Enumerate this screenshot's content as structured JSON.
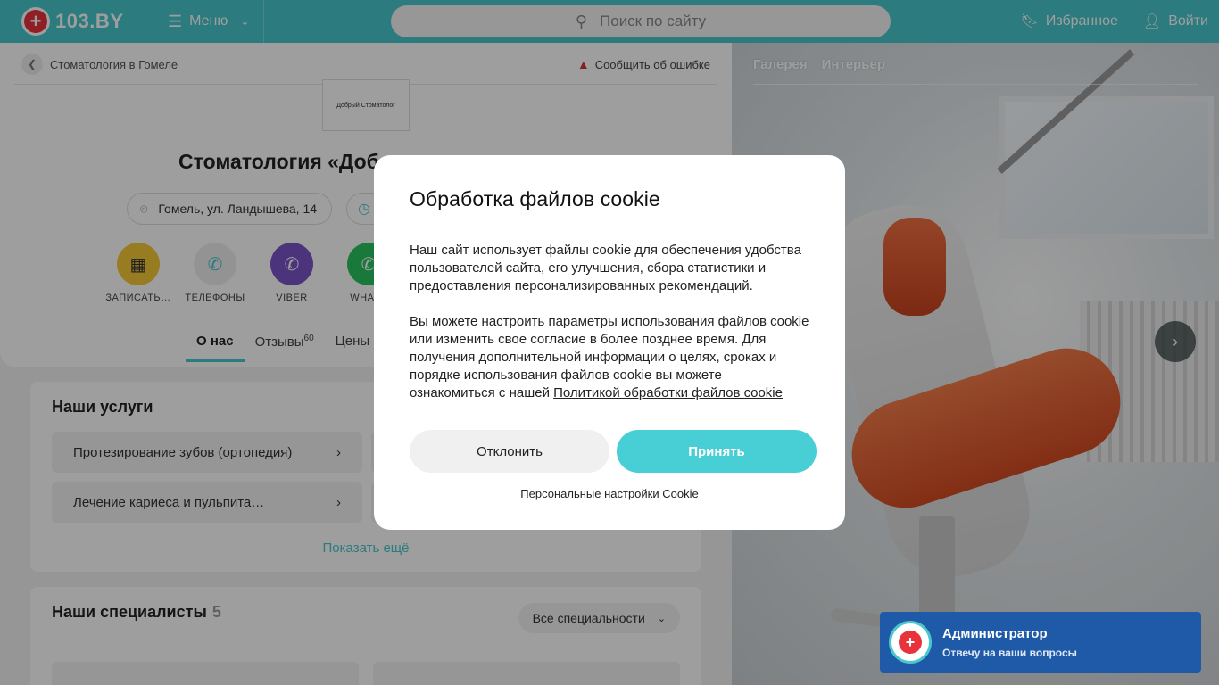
{
  "header": {
    "logo_text": "103.BY",
    "menu_label": "Меню",
    "search_placeholder": "Поиск по сайту",
    "favorites_label": "Избранное",
    "login_label": "Войти"
  },
  "breadcrumb": {
    "label": "Стоматология в Гомеле"
  },
  "report_label": "Сообщить об ошибке",
  "clinic": {
    "logo_text": "Добрый Стоматолог",
    "title": "Стоматология «Доб",
    "address": "Гомель, ул. Ландышева, 14"
  },
  "actions": [
    {
      "label": "ЗАПИСАТЬ…",
      "color": "#f6c836"
    },
    {
      "label": "ТЕЛЕФОНЫ",
      "color": "#eeeeee"
    },
    {
      "label": "VIBER",
      "color": "#7a55c7"
    },
    {
      "label": "WHATS",
      "color": "#27c35f"
    }
  ],
  "tabs": [
    {
      "label": "О нас",
      "count": ""
    },
    {
      "label": "Отзывы",
      "count": "60"
    },
    {
      "label": "Цены",
      "count": ""
    }
  ],
  "services": {
    "title": "Наши услуги",
    "items": [
      "Протезирование зубов (ортопедия)",
      "Лечение кариеса и пульпита…"
    ],
    "more_label": "Показать ещё"
  },
  "specialists": {
    "title": "Наши специалисты",
    "count": "5",
    "filter_label": "Все специальности"
  },
  "gallery": {
    "tabs": [
      "Галерея",
      "Интерьер"
    ]
  },
  "chat": {
    "title": "Администратор",
    "subtitle": "Отвечу на ваши вопросы"
  },
  "cookie_modal": {
    "title": "Обработка файлов cookie",
    "paragraph1": "Наш сайт использует файлы cookie для обеспечения удобства пользователей сайта, его улучшения, сбора статистики и предоставления персонализированных рекомендаций.",
    "paragraph2": "Вы можете настроить параметры использования файлов cookie или изменить свое согласие в более позднее время. Для получения дополнительной информации о целях, сроках и порядке использования файлов cookie вы можете ознакомиться с нашей",
    "policy_link": "Политикой обработки файлов cookie",
    "decline_label": "Отклонить",
    "accept_label": "Принять",
    "settings_label": "Персональные настройки Cookie"
  },
  "colors": {
    "brand": "#48c7cd",
    "accept": "#48cfd6",
    "chat_bg": "#1e5aa8",
    "logo_red": "#e8323c"
  }
}
